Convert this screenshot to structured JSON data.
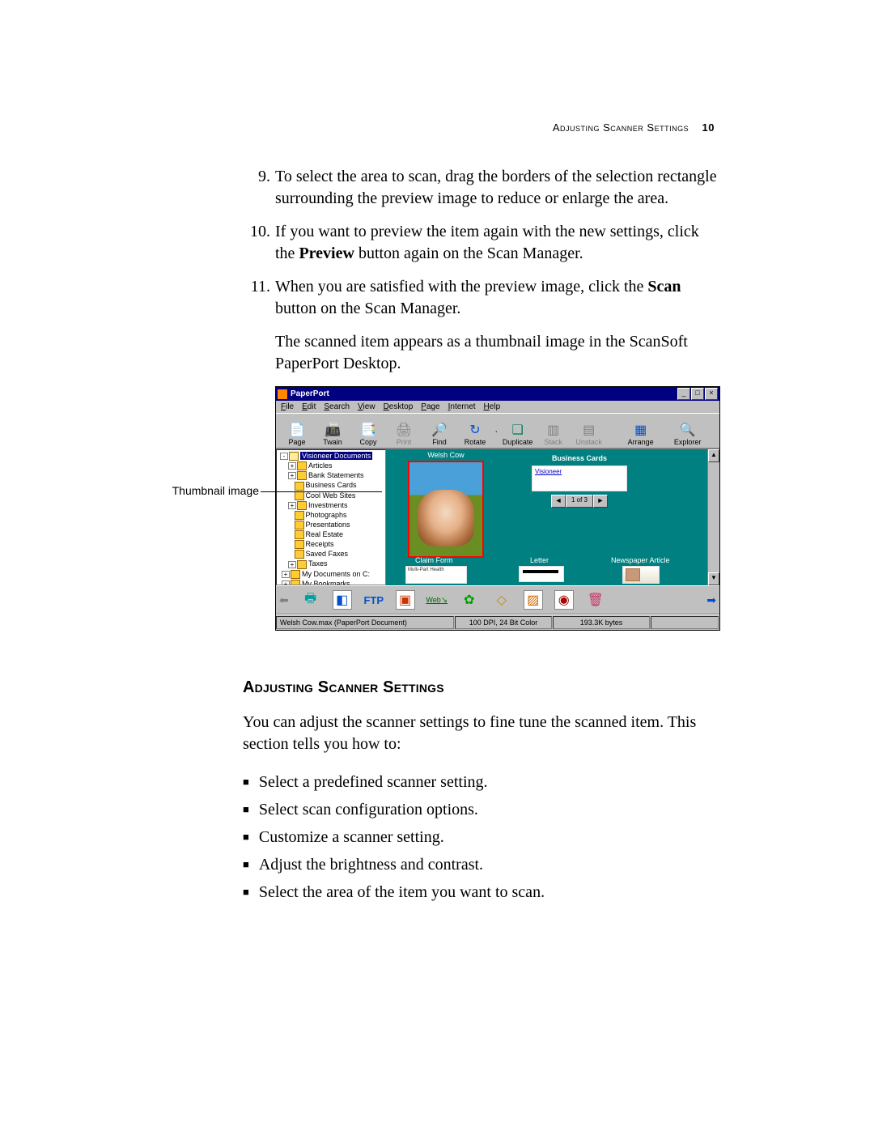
{
  "header": {
    "title": "Adjusting Scanner Settings",
    "page_number": "10"
  },
  "steps": [
    {
      "n": "9.",
      "text_a": "To select the area to scan, drag the borders of the selection rectangle surrounding the preview image to reduce or enlarge the area."
    },
    {
      "n": "10.",
      "text_a": "If you want to preview the item again with the new settings, click the ",
      "bold": "Preview",
      "text_b": " button again on the Scan Manager."
    },
    {
      "n": "11.",
      "text_a": "When you are satisfied with the preview image, click the ",
      "bold": "Scan",
      "text_b": " button on the Scan Manager."
    }
  ],
  "followup": "The scanned item appears as a thumbnail image in the ScanSoft PaperPort Desktop.",
  "callout": "Thumbnail image",
  "screenshot": {
    "title": "PaperPort",
    "window_buttons": {
      "min": "_",
      "max": "□",
      "close": "×"
    },
    "menus": [
      "File",
      "Edit",
      "Search",
      "View",
      "Desktop",
      "Page",
      "Internet",
      "Help"
    ],
    "toolbar": [
      {
        "label": "Page",
        "icon": "📄",
        "dim": false
      },
      {
        "label": "Twain",
        "icon": "📠",
        "dim": false
      },
      {
        "label": "Copy",
        "icon": "📑",
        "dim": false
      },
      {
        "label": "Print",
        "icon": "🖨",
        "dim": true
      },
      {
        "label": "Find",
        "icon": "🔎",
        "dim": false
      },
      {
        "label": "Rotate",
        "icon": "↻",
        "dim": false
      },
      {
        "label": "Duplicate",
        "icon": "❏",
        "dim": false
      },
      {
        "label": "Stack",
        "icon": "▥",
        "dim": true
      },
      {
        "label": "Unstack",
        "icon": "▤",
        "dim": true
      },
      {
        "label": "Arrange",
        "icon": "▦",
        "dim": false
      },
      {
        "label": "Explorer",
        "icon": "🔍",
        "dim": false
      }
    ],
    "tree": {
      "root": "Visioneer Documents",
      "items": [
        "Articles",
        "Bank Statements",
        "Business Cards",
        "Cool Web Sites",
        "Investments",
        "Photographs",
        "Presentations",
        "Real Estate",
        "Receipts",
        "Saved Faxes",
        "Taxes"
      ],
      "extra": [
        "My Documents on C:",
        "My Bookmarks"
      ]
    },
    "thumbs": {
      "t1_label": "Welsh Cow",
      "t2_label": "Business Cards",
      "t2_line1": "Visioneer",
      "pager": "1 of 3",
      "row2": [
        "Claim Form",
        "Letter",
        "Newspaper Article"
      ],
      "mini1_lines": "Multi-Part\nHealth"
    },
    "shortcuts": {
      "ftp": "FTP",
      "web": "Web"
    },
    "status": {
      "file": "Welsh Cow.max (PaperPort Document)",
      "res": "100 DPI, 24 Bit Color",
      "size": "193.3K bytes"
    }
  },
  "section": {
    "heading": "Adjusting Scanner Settings",
    "intro": "You can adjust the scanner settings to fine tune the scanned item. This section tells you how to:",
    "bullets": [
      "Select a predefined scanner setting.",
      "Select scan configuration options.",
      "Customize a scanner setting.",
      "Adjust the brightness and contrast.",
      "Select the area of the item you want to scan."
    ]
  }
}
